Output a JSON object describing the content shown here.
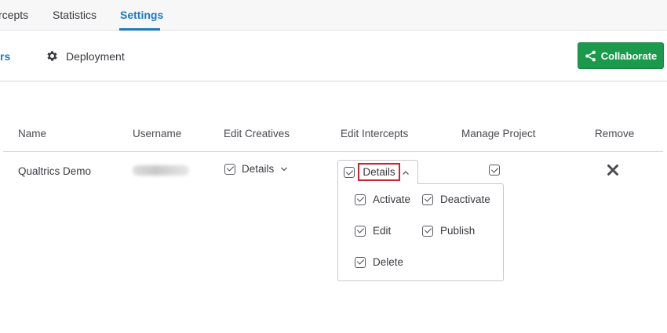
{
  "tabs": [
    {
      "label": "rcepts",
      "active": false
    },
    {
      "label": "Statistics",
      "active": false
    },
    {
      "label": "Settings",
      "active": true
    }
  ],
  "subnav": {
    "cut_label": "rs",
    "deployment_label": "Deployment",
    "collaborate_label": "Collaborate"
  },
  "table": {
    "headers": {
      "name": "Name",
      "username": "Username",
      "edit_creatives": "Edit Creatives",
      "edit_intercepts": "Edit Intercepts",
      "manage_project": "Manage Project",
      "remove": "Remove"
    },
    "row": {
      "name": "Qualtrics Demo",
      "username_blurred": true,
      "edit_creatives_label": "Details",
      "edit_intercepts_label": "Details",
      "manage_project_checked": true
    }
  },
  "dropdown": {
    "options": [
      {
        "label": "Activate",
        "checked": true
      },
      {
        "label": "Deactivate",
        "checked": true
      },
      {
        "label": "Edit",
        "checked": true
      },
      {
        "label": "Publish",
        "checked": true
      },
      {
        "label": "Delete",
        "checked": true
      }
    ]
  },
  "colors": {
    "accent": "#1a7bbf",
    "collaborate_green": "#1c9a4b",
    "highlight_red": "#c8262f"
  },
  "icons": {
    "deployment": "gear-icon",
    "collaborate": "share-icon",
    "remove": "close-icon",
    "expand": "chevron-down-icon",
    "collapse": "chevron-up-icon"
  }
}
